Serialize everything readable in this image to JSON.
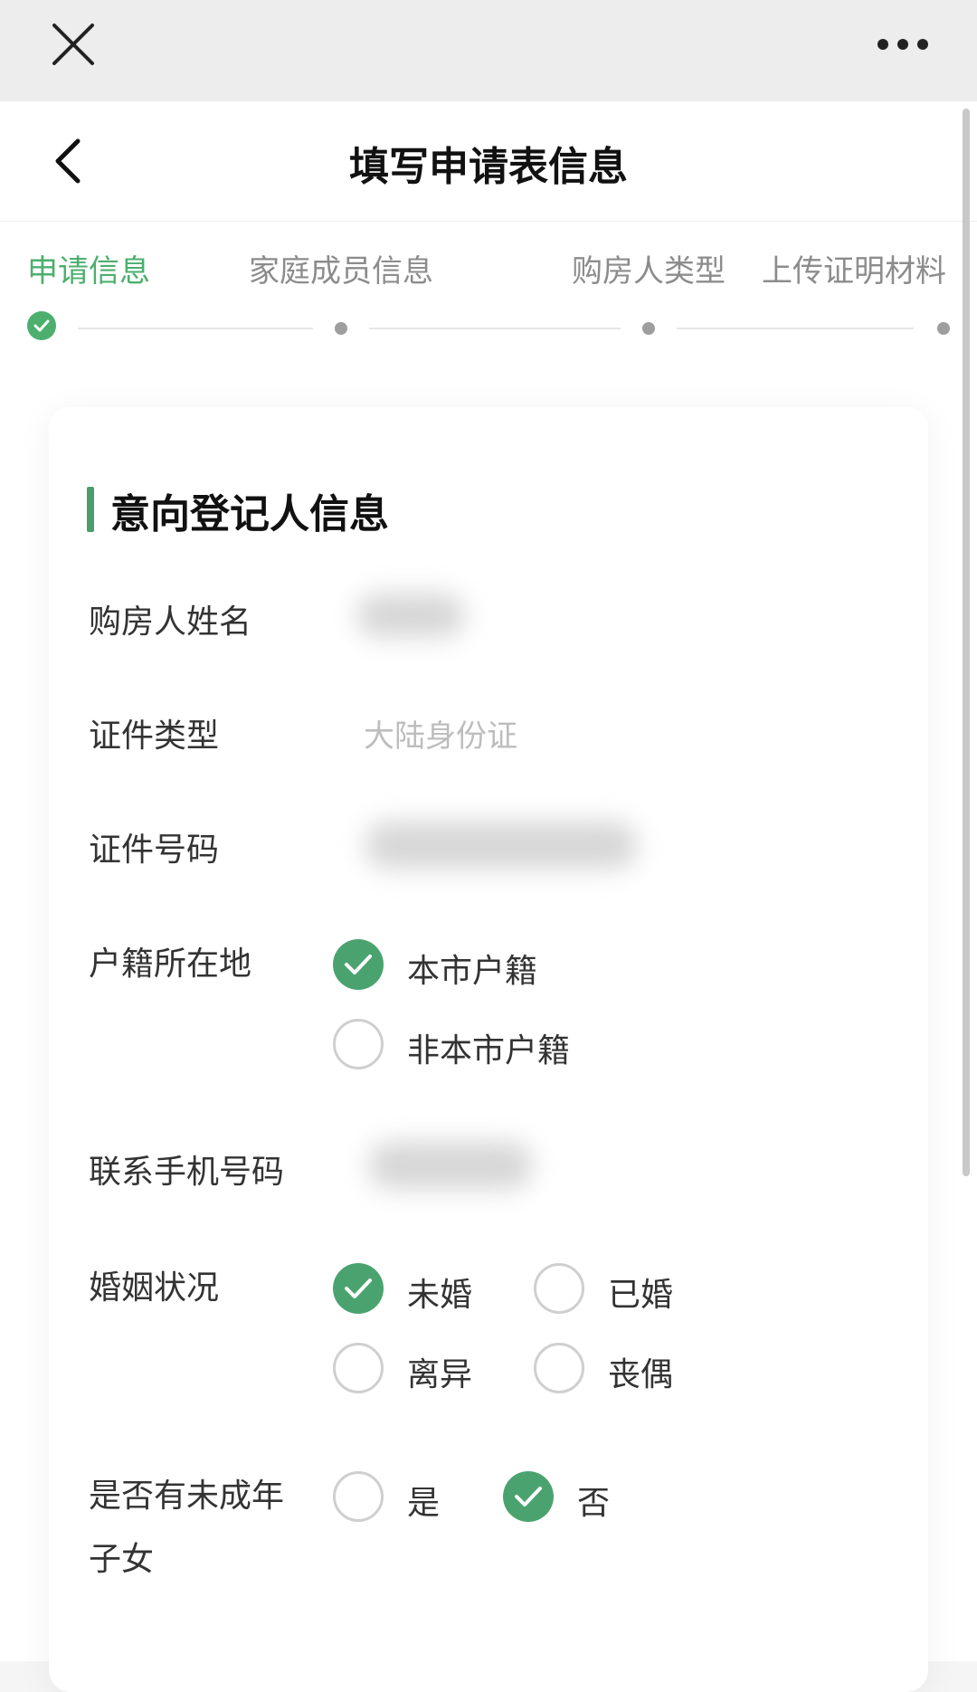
{
  "topbar": {
    "close_icon": "close-icon",
    "more_icon": "more-horizontal-icon"
  },
  "navbar": {
    "title": "填写申请表信息",
    "back_icon": "chevron-left-icon"
  },
  "steps": [
    {
      "label": "申请信息",
      "state": "done"
    },
    {
      "label": "家庭成员信息",
      "state": "pending"
    },
    {
      "label": "购房人类型",
      "state": "pending"
    },
    {
      "label": "上传证明材料",
      "state": "pending"
    }
  ],
  "section": {
    "title": "意向登记人信息"
  },
  "fields": {
    "buyer_name_label": "购房人姓名",
    "id_type_label": "证件类型",
    "id_type_value": "大陆身份证",
    "id_number_label": "证件号码",
    "household_label": "户籍所在地",
    "household_options": [
      {
        "label": "本市户籍",
        "checked": true
      },
      {
        "label": "非本市户籍",
        "checked": false
      }
    ],
    "phone_label": "联系手机号码",
    "marital_label": "婚姻状况",
    "marital_options": [
      {
        "label": "未婚",
        "checked": true
      },
      {
        "label": "已婚",
        "checked": false
      },
      {
        "label": "离异",
        "checked": false
      },
      {
        "label": "丧偶",
        "checked": false
      }
    ],
    "minor_children_label_line1": "是否有未成年",
    "minor_children_label_line2": "子女",
    "minor_children_options": [
      {
        "label": "是",
        "checked": false
      },
      {
        "label": "否",
        "checked": true
      }
    ]
  },
  "colors": {
    "accent": "#4aa36f",
    "step_active": "#4caf6e"
  }
}
